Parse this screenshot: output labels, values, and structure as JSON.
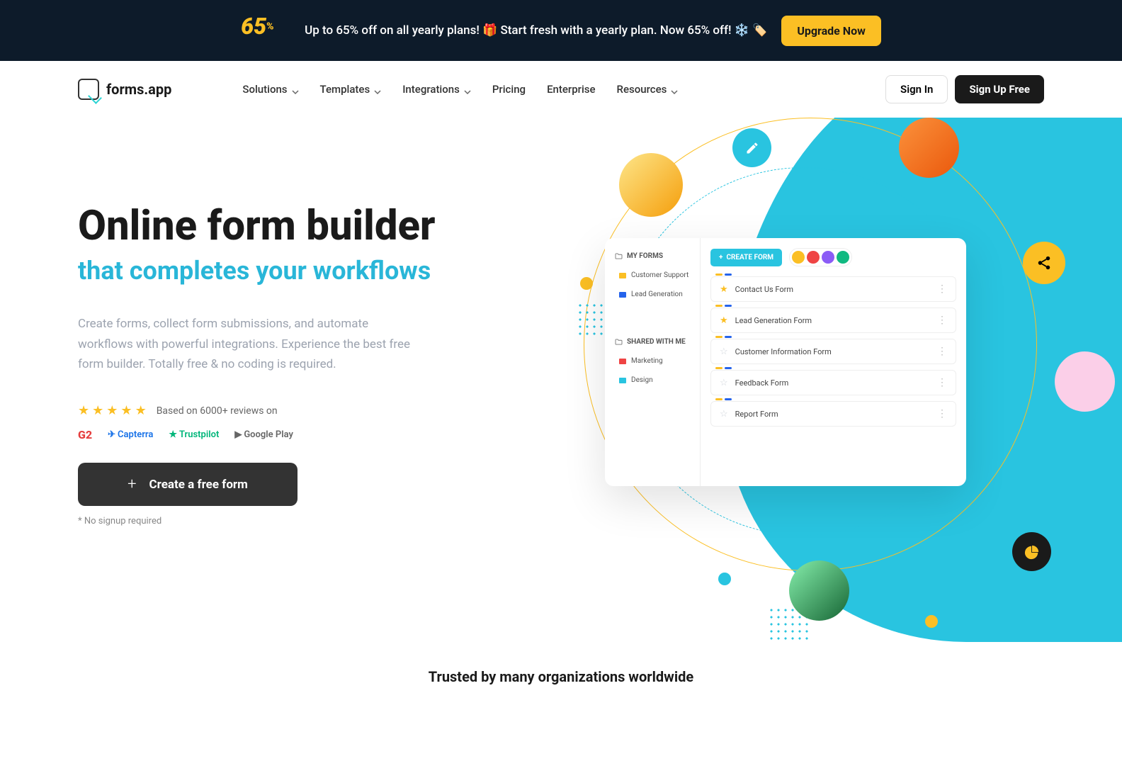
{
  "promo": {
    "badge_number": "65",
    "badge_pct": "%",
    "text": "Up to 65% off on all yearly plans! 🎁 Start fresh with a yearly plan. Now 65% off! ❄️ 🏷️",
    "button": "Upgrade Now"
  },
  "brand": "forms.app",
  "nav": {
    "solutions": "Solutions",
    "templates": "Templates",
    "integrations": "Integrations",
    "pricing": "Pricing",
    "enterprise": "Enterprise",
    "resources": "Resources"
  },
  "auth": {
    "signin": "Sign In",
    "signup": "Sign Up Free"
  },
  "hero": {
    "title": "Online form builder",
    "subtitle": "that completes your workflows",
    "desc": "Create forms, collect form submissions, and automate workflows with powerful integrations. Experience the best free form builder. Totally free & no coding is required.",
    "rating_text": "Based on 6000+ reviews on",
    "reviews": {
      "g2": "G2",
      "capterra": "Capterra",
      "trustpilot": "Trustpilot",
      "googleplay": "Google Play"
    },
    "cta": "Create a free form",
    "cta_note": "* No signup required"
  },
  "app": {
    "my_forms": "MY FORMS",
    "shared_with_me": "SHARED WITH ME",
    "sidebar": {
      "customer_support": "Customer Support",
      "lead_generation": "Lead Generation",
      "marketing": "Marketing",
      "design": "Design"
    },
    "create_form": "CREATE FORM",
    "forms": [
      {
        "name": "Contact Us Form",
        "starred": true
      },
      {
        "name": "Lead Generation Form",
        "starred": true
      },
      {
        "name": "Customer Information Form",
        "starred": false
      },
      {
        "name": "Feedback Form",
        "starred": false
      },
      {
        "name": "Report Form",
        "starred": false
      }
    ]
  },
  "trusted": "Trusted by many organizations worldwide"
}
